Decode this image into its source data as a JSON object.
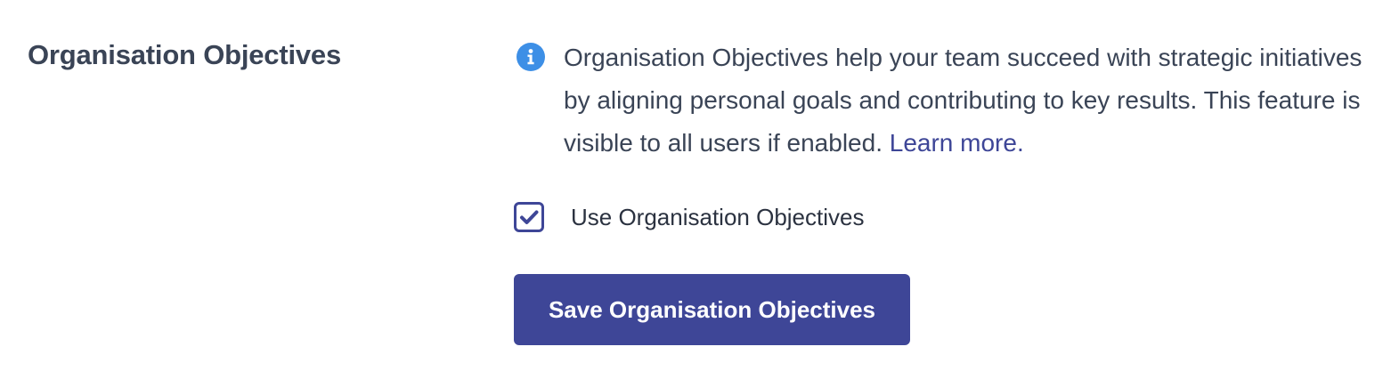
{
  "section": {
    "title": "Organisation Objectives"
  },
  "info": {
    "icon": "info-icon",
    "description": "Organisation Objectives help your team succeed with strategic initiatives by aligning personal goals and contributing to key results. This feature is visible to all users if enabled.",
    "link_text": "Learn more."
  },
  "checkbox": {
    "label": "Use Organisation Objectives",
    "checked": true,
    "icon": "checkmark-icon"
  },
  "save_button": {
    "label": "Save Organisation Objectives"
  },
  "colors": {
    "primary": "#3e4697",
    "info_icon": "#3d8fe6",
    "text": "#3a4456"
  }
}
